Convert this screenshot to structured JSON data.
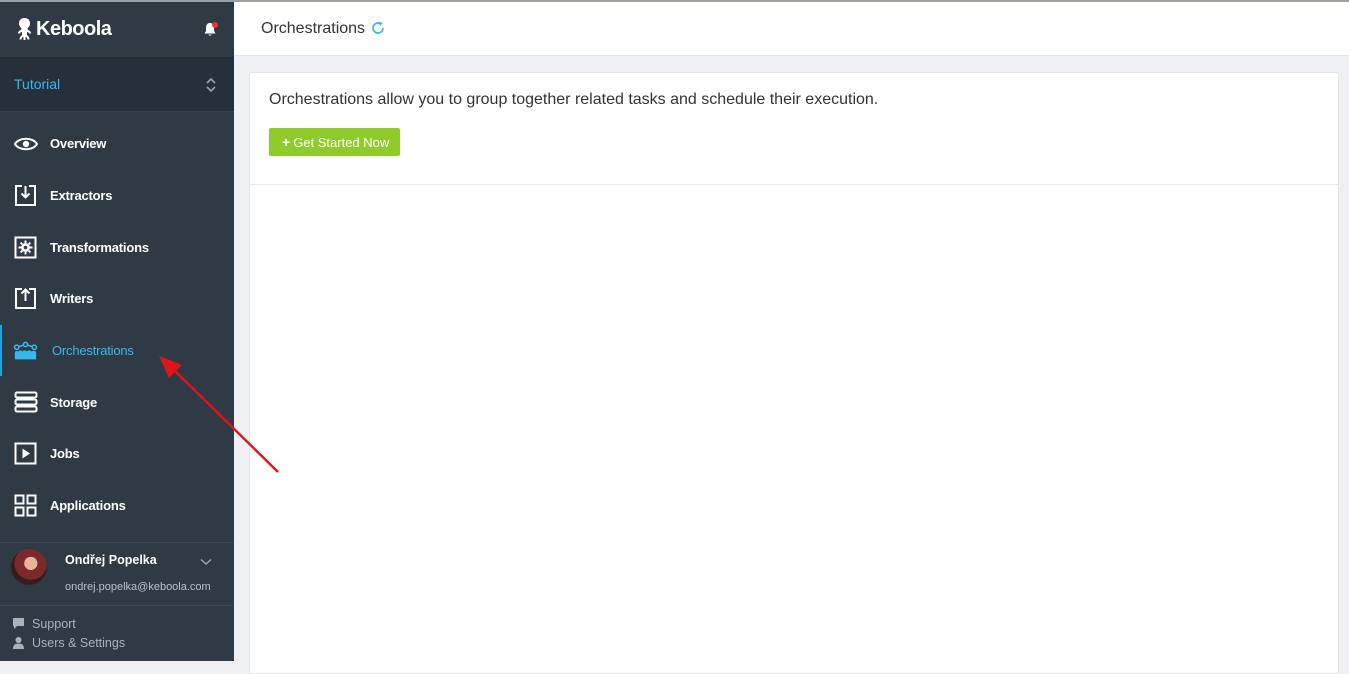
{
  "app": {
    "name": "Keboola"
  },
  "project": {
    "name": "Tutorial"
  },
  "nav": {
    "items": [
      {
        "label": "Overview",
        "icon": "eye-icon"
      },
      {
        "label": "Extractors",
        "icon": "download-box-icon"
      },
      {
        "label": "Transformations",
        "icon": "gear-box-icon"
      },
      {
        "label": "Writers",
        "icon": "upload-box-icon"
      },
      {
        "label": "Orchestrations",
        "icon": "orchestration-icon",
        "active": true
      },
      {
        "label": "Storage",
        "icon": "storage-icon"
      },
      {
        "label": "Jobs",
        "icon": "play-box-icon"
      },
      {
        "label": "Applications",
        "icon": "grid-icon"
      }
    ]
  },
  "user": {
    "name": "Ondřej Popelka",
    "email": "ondrej.popelka@keboola.com"
  },
  "footer": {
    "support": "Support",
    "settings": "Users & Settings"
  },
  "header": {
    "title": "Orchestrations"
  },
  "main": {
    "intro": "Orchestrations allow you to group together related tasks and schedule their execution.",
    "cta_label": "Get Started Now",
    "cta_prefix": "+"
  },
  "colors": {
    "sidebar_bg": "#2f3a45",
    "accent": "#3ab8f0",
    "cta": "#8ecb2b",
    "annotation_arrow": "#e0141a",
    "notification_dot": "#e53935"
  }
}
